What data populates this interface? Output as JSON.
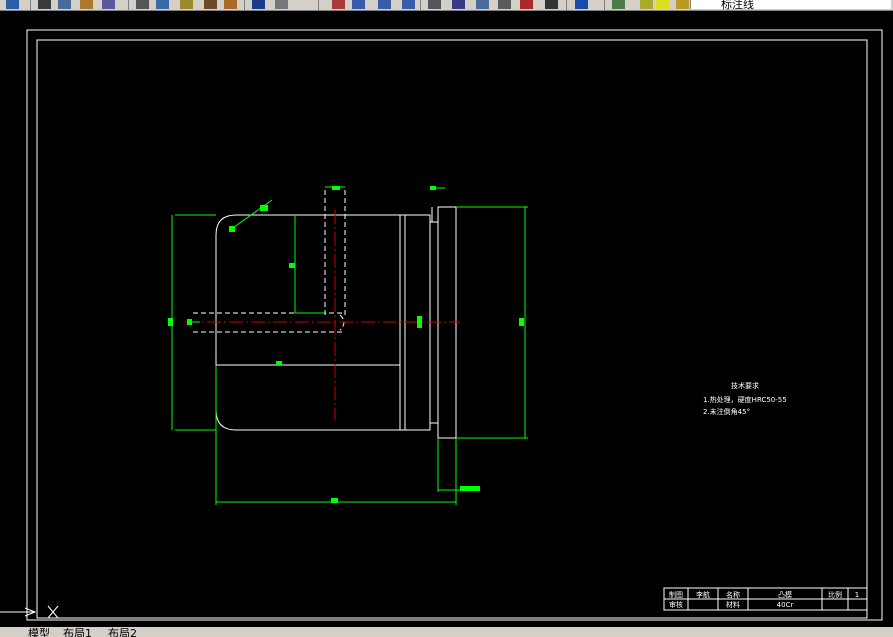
{
  "toolbar": {
    "layer_name": "标注线",
    "buttons": [
      "save-icon",
      "print-icon",
      "preview-icon",
      "publish-icon",
      "plot-icon",
      "cut-icon",
      "copy-icon",
      "paste-icon",
      "match-icon",
      "brush-icon",
      "undo-icon",
      "redo-icon",
      "pan-icon",
      "zoom-realtime-icon",
      "zoom-window-icon",
      "zoom-previous-icon",
      "properties-icon",
      "design-center-icon",
      "tool-palette-icon",
      "sheet-set-icon",
      "markup-icon",
      "calculator-icon",
      "help-icon",
      "layer-manager-icon",
      "bulb-icon",
      "sun-icon",
      "lock-icon",
      "color-icon"
    ]
  },
  "drawing": {
    "tech_title": "技术要求",
    "tech_line1": "1.热处理，硬度HRC50-55",
    "tech_line2": "2.未注倒角45°",
    "title_block": {
      "row1": [
        "制图",
        "李航",
        "名称",
        "凸模",
        "比例",
        "1"
      ],
      "row2": [
        "审核",
        "",
        "材料",
        "40Cr",
        "",
        ""
      ]
    }
  },
  "tabs": [
    "模型",
    "布局1",
    "布局2"
  ]
}
